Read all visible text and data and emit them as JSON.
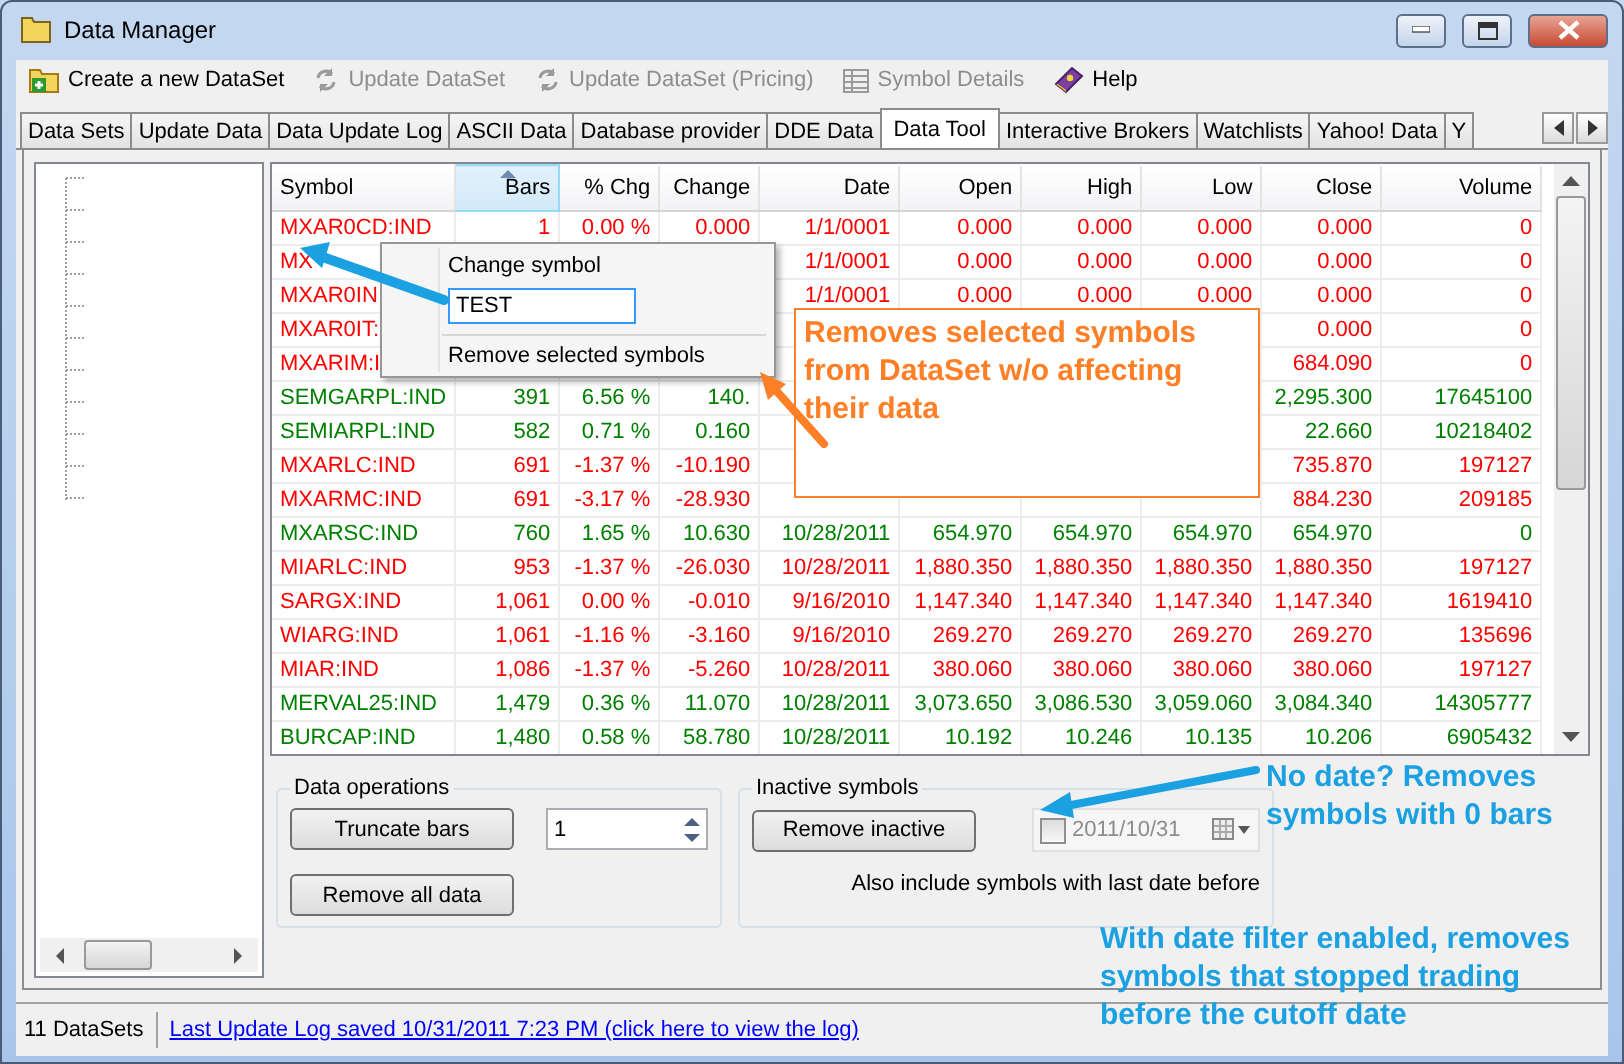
{
  "window": {
    "title": "Data Manager"
  },
  "toolbar": [
    {
      "label": "Create a new DataSet",
      "disabled": false
    },
    {
      "label": "Update DataSet",
      "disabled": true
    },
    {
      "label": "Update DataSet (Pricing)",
      "disabled": true
    },
    {
      "label": "Symbol Details",
      "disabled": true
    },
    {
      "label": "Help",
      "disabled": false
    }
  ],
  "tabs": [
    {
      "label": "Data Sets",
      "selected": false
    },
    {
      "label": "Update Data",
      "selected": false
    },
    {
      "label": "Data Update Log",
      "selected": false
    },
    {
      "label": "ASCII Data",
      "selected": false
    },
    {
      "label": "Database provider",
      "selected": false
    },
    {
      "label": "DDE Data",
      "selected": false
    },
    {
      "label": "Data Tool",
      "selected": true
    },
    {
      "label": "Interactive Brokers",
      "selected": false
    },
    {
      "label": "Watchlists",
      "selected": false
    },
    {
      "label": "Yahoo! Data",
      "selected": false
    },
    {
      "label": "Y",
      "selected": false
    }
  ],
  "table": {
    "columns": [
      {
        "label": "Symbol",
        "sorted": false
      },
      {
        "label": "Bars",
        "sorted": true
      },
      {
        "label": "% Chg",
        "sorted": false
      },
      {
        "label": "Change",
        "sorted": false
      },
      {
        "label": "Date",
        "sorted": false
      },
      {
        "label": "Open",
        "sorted": false
      },
      {
        "label": "High",
        "sorted": false
      },
      {
        "label": "Low",
        "sorted": false
      },
      {
        "label": "Close",
        "sorted": false
      },
      {
        "label": "Volume",
        "sorted": false
      }
    ],
    "rows": [
      {
        "color": "#ff0000",
        "cells": [
          "MXAR0CD:IND",
          "1",
          "0.00 %",
          "0.000",
          "1/1/0001",
          "0.000",
          "0.000",
          "0.000",
          "0.000",
          "0"
        ]
      },
      {
        "color": "#ff0000",
        "cells": [
          "MX",
          null,
          null,
          null,
          "1/1/0001",
          "0.000",
          "0.000",
          "0.000",
          "0.000",
          "0"
        ]
      },
      {
        "color": "#ff0000",
        "cells": [
          "MXAR0IN",
          null,
          null,
          null,
          "1/1/0001",
          "0.000",
          "0.000",
          "0.000",
          "0.000",
          "0"
        ]
      },
      {
        "color": "#ff0000",
        "cells": [
          "MXAR0IT:",
          null,
          null,
          null,
          null,
          null,
          null,
          null,
          "0.000",
          "0"
        ]
      },
      {
        "color": "#ff0000",
        "cells": [
          "MXARIM:I",
          null,
          null,
          null,
          null,
          null,
          null,
          null,
          "684.090",
          "0"
        ]
      },
      {
        "color": "#008000",
        "cells": [
          "SEMGARPL:IND",
          "391",
          "6.56 %",
          "140.",
          null,
          null,
          null,
          null,
          "2,295.300",
          "17645100"
        ]
      },
      {
        "color": "#008000",
        "cells": [
          "SEMIARPL:IND",
          "582",
          "0.71 %",
          "0.160",
          null,
          null,
          null,
          null,
          "22.660",
          "10218402"
        ]
      },
      {
        "color": "#ff0000",
        "cells": [
          "MXARLC:IND",
          "691",
          "-1.37 %",
          "-10.190",
          null,
          null,
          null,
          null,
          "735.870",
          "197127"
        ]
      },
      {
        "color": "#ff0000",
        "cells": [
          "MXARMC:IND",
          "691",
          "-3.17 %",
          "-28.930",
          null,
          null,
          null,
          null,
          "884.230",
          "209185"
        ]
      },
      {
        "color": "#008000",
        "cells": [
          "MXARSC:IND",
          "760",
          "1.65 %",
          "10.630",
          "10/28/2011",
          "654.970",
          "654.970",
          "654.970",
          "654.970",
          "0"
        ]
      },
      {
        "color": "#ff0000",
        "cells": [
          "MIARLC:IND",
          "953",
          "-1.37 %",
          "-26.030",
          "10/28/2011",
          "1,880.350",
          "1,880.350",
          "1,880.350",
          "1,880.350",
          "197127"
        ]
      },
      {
        "color": "#ff0000",
        "cells": [
          "SARGX:IND",
          "1,061",
          "0.00 %",
          "-0.010",
          "9/16/2010",
          "1,147.340",
          "1,147.340",
          "1,147.340",
          "1,147.340",
          "1619410"
        ]
      },
      {
        "color": "#ff0000",
        "cells": [
          "WIARG:IND",
          "1,061",
          "-1.16 %",
          "-3.160",
          "9/16/2010",
          "269.270",
          "269.270",
          "269.270",
          "269.270",
          "135696"
        ]
      },
      {
        "color": "#ff0000",
        "cells": [
          "MIAR:IND",
          "1,086",
          "-1.37 %",
          "-5.260",
          "10/28/2011",
          "380.060",
          "380.060",
          "380.060",
          "380.060",
          "197127"
        ]
      },
      {
        "color": "#008000",
        "cells": [
          "MERVAL25:IND",
          "1,479",
          "0.36 %",
          "11.070",
          "10/28/2011",
          "3,073.650",
          "3,086.530",
          "3,059.060",
          "3,084.340",
          "14305777"
        ]
      },
      {
        "color": "#008000",
        "cells": [
          "BURCAP:IND",
          "1,480",
          "0.58 %",
          "58.780",
          "10/28/2011",
          "10.192",
          "10.246",
          "10.135",
          "10.206",
          "6905432"
        ]
      }
    ]
  },
  "context_menu": {
    "title": "Change symbol",
    "value": "TEST",
    "action": "Remove selected symbols"
  },
  "data_operations": {
    "title": "Data operations",
    "truncate": "Truncate bars",
    "spin_value": "1",
    "remove_all": "Remove all data"
  },
  "inactive_symbols": {
    "title": "Inactive symbols",
    "button": "Remove inactive",
    "date_enabled": false,
    "date": "2011/10/31",
    "note": "Also include symbols with last date before"
  },
  "callouts": [
    {
      "color": "#ff7f27",
      "boxed": true,
      "lines": [
        "Removes selected symbols",
        "from DataSet w/o affecting",
        "their data"
      ]
    },
    {
      "color": "#1ba1e2",
      "boxed": false,
      "lines": [
        "No date? Removes",
        "symbols with 0 bars"
      ]
    },
    {
      "color": "#1ba1e2",
      "boxed": false,
      "lines": [
        "With date filter enabled, removes",
        "symbols that stopped trading",
        "before the cutoff date"
      ]
    }
  ],
  "status_bar": {
    "count": "11 DataSets",
    "link": "Last Update Log saved 10/31/2011 7:23 PM (click here to view the log)"
  }
}
